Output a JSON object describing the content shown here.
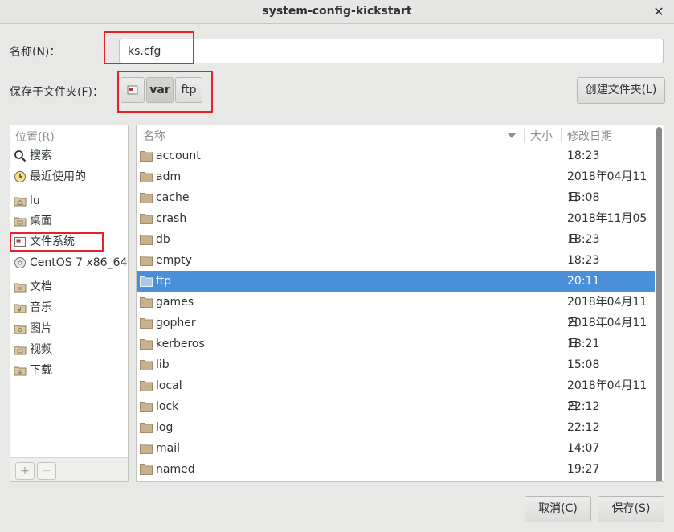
{
  "window": {
    "title": "system-config-kickstart",
    "close_glyph": "✕"
  },
  "name": {
    "label": "名称(N)：",
    "value": "ks.cfg"
  },
  "save_in": {
    "label": "保存于文件夹(F)：",
    "path": [
      "var",
      "ftp"
    ],
    "new_folder_label": "创建文件夹(L)"
  },
  "places": {
    "header": "位置(R)",
    "items": [
      {
        "label": "搜索",
        "icon": "search-icon"
      },
      {
        "label": "最近使用的",
        "icon": "recent-icon"
      },
      {
        "label": "lu",
        "icon": "home-folder-icon"
      },
      {
        "label": "桌面",
        "icon": "desktop-folder-icon"
      },
      {
        "label": "文件系统",
        "icon": "drive-icon"
      },
      {
        "label": "CentOS 7 x86_64",
        "icon": "disc-icon"
      },
      {
        "label": "文档",
        "icon": "documents-folder-icon"
      },
      {
        "label": "音乐",
        "icon": "music-folder-icon"
      },
      {
        "label": "图片",
        "icon": "pictures-folder-icon"
      },
      {
        "label": "视频",
        "icon": "videos-folder-icon"
      },
      {
        "label": "下载",
        "icon": "downloads-folder-icon"
      }
    ],
    "add_glyph": "+",
    "remove_glyph": "—"
  },
  "files": {
    "columns": {
      "name": "名称",
      "size": "大小",
      "modified": "修改日期"
    },
    "rows": [
      {
        "name": "account",
        "modified": "18:23"
      },
      {
        "name": "adm",
        "modified": "2018年04月11日"
      },
      {
        "name": "cache",
        "modified": "15:08"
      },
      {
        "name": "crash",
        "modified": "2018年11月05日"
      },
      {
        "name": "db",
        "modified": "18:23"
      },
      {
        "name": "empty",
        "modified": "18:23"
      },
      {
        "name": "ftp",
        "modified": "20:11",
        "selected": true
      },
      {
        "name": "games",
        "modified": "2018年04月11日"
      },
      {
        "name": "gopher",
        "modified": "2018年04月11日"
      },
      {
        "name": "kerberos",
        "modified": "18:21"
      },
      {
        "name": "lib",
        "modified": "15:08"
      },
      {
        "name": "local",
        "modified": "2018年04月11日"
      },
      {
        "name": "lock",
        "modified": "22:12"
      },
      {
        "name": "log",
        "modified": "22:12"
      },
      {
        "name": "mail",
        "modified": "14:07"
      },
      {
        "name": "named",
        "modified": "19:27"
      }
    ]
  },
  "buttons": {
    "cancel": "取消(C)",
    "save": "保存(S)"
  },
  "colors": {
    "selection": "#4a90d9",
    "highlight_box": "#e8202a",
    "folder": "#c8b18f"
  }
}
